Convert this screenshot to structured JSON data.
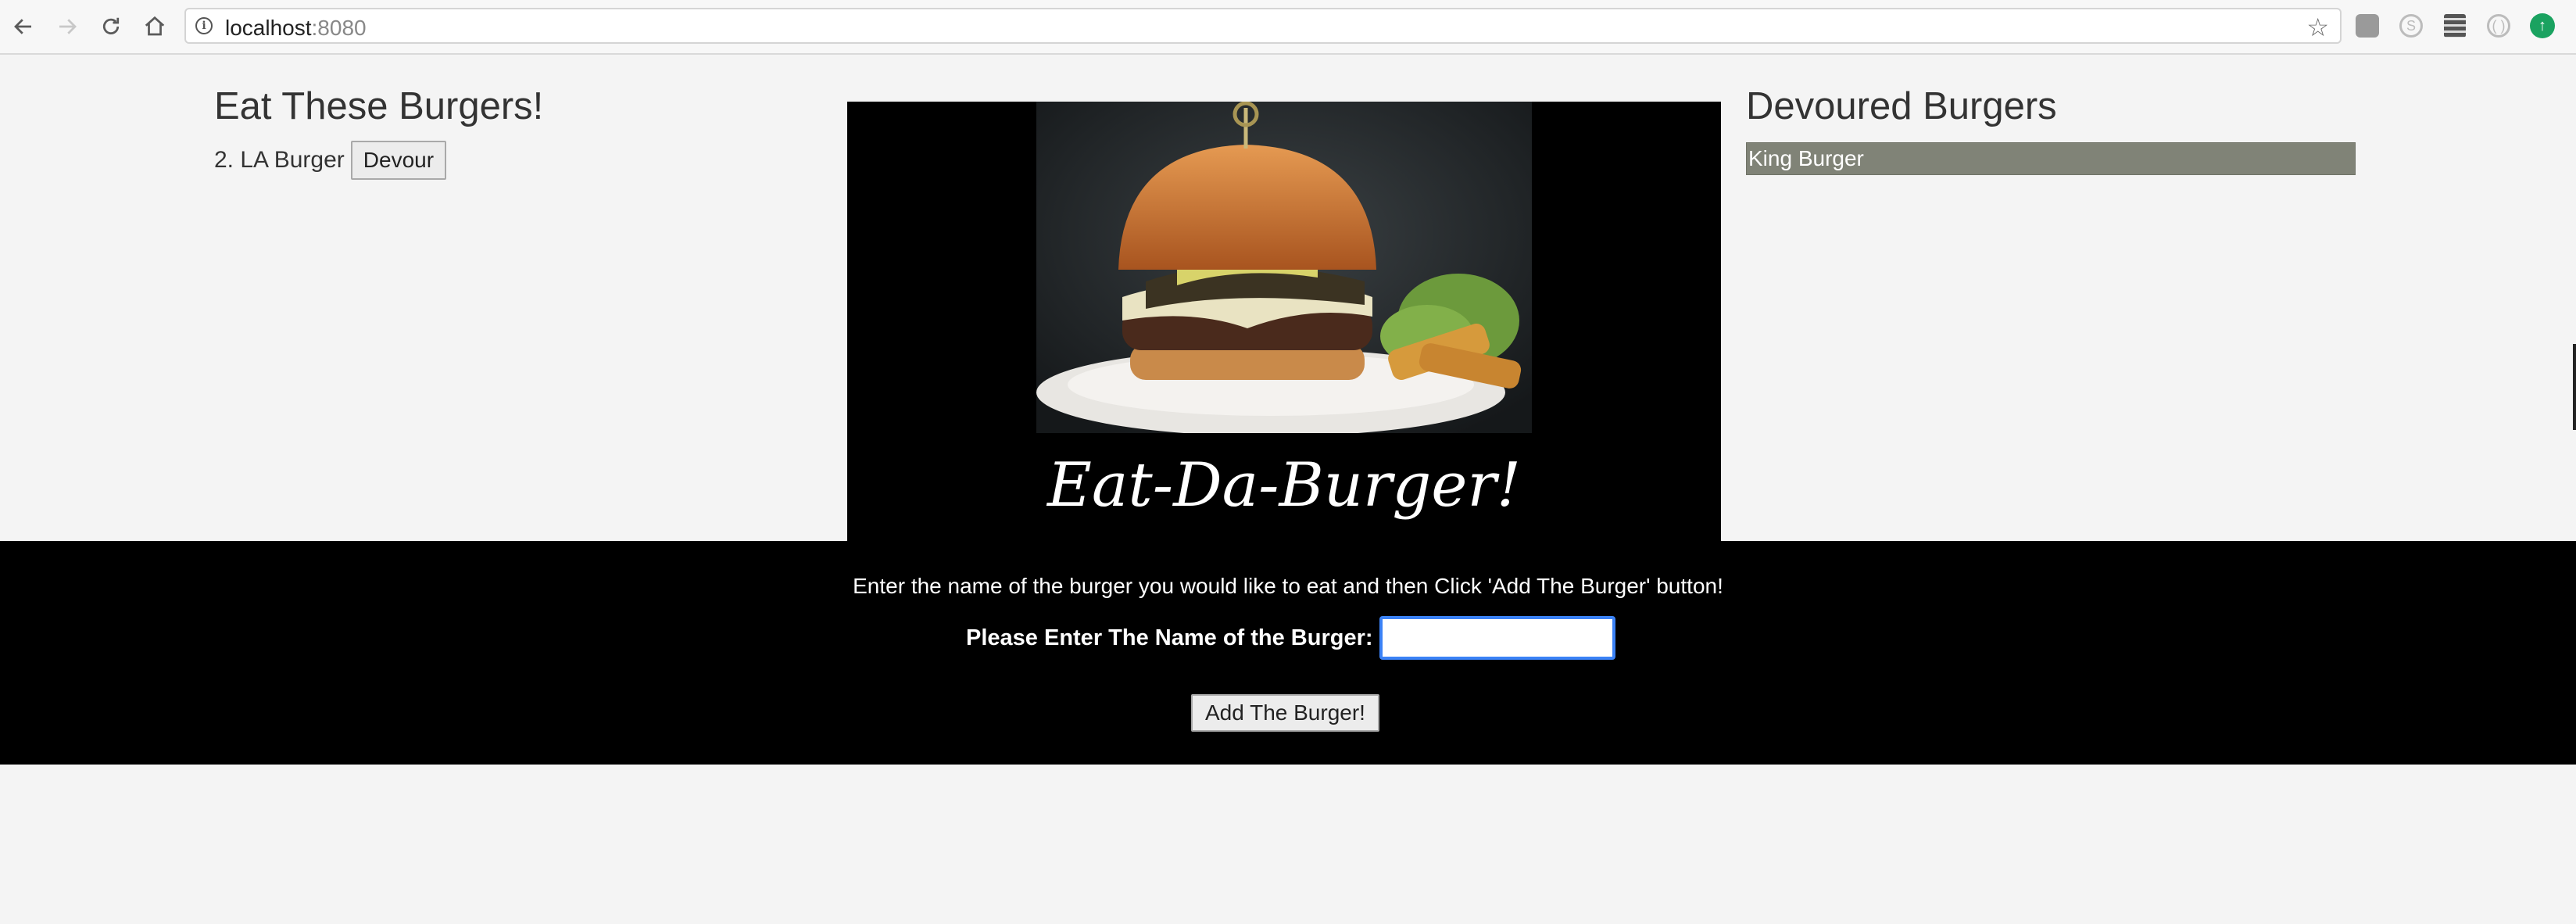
{
  "browser": {
    "url_host": "localhost",
    "url_port": ":8080",
    "icons": {
      "back": "arrow-left-icon",
      "forward": "arrow-right-icon",
      "reload": "reload-icon",
      "home": "home-icon",
      "info": "info-icon",
      "bookmark": "star-icon"
    }
  },
  "left": {
    "heading": "Eat These Burgers!",
    "items": [
      {
        "label": "2. LA Burger",
        "button": "Devour"
      }
    ]
  },
  "hero": {
    "title": "Eat-Da-Burger!"
  },
  "right": {
    "heading": "Devoured Burgers",
    "items": [
      "King Burger"
    ]
  },
  "form": {
    "instructions": "Enter the name of the burger you would like to eat and then Click 'Add The Burger' button!",
    "label": "Please Enter The Name of the Burger:",
    "input_value": "",
    "submit_label": "Add The Burger!"
  },
  "colors": {
    "devoured_bg": "#808377",
    "band_bg": "#000000",
    "page_bg": "#f4f4f4",
    "focus_ring": "#3b82f6"
  }
}
